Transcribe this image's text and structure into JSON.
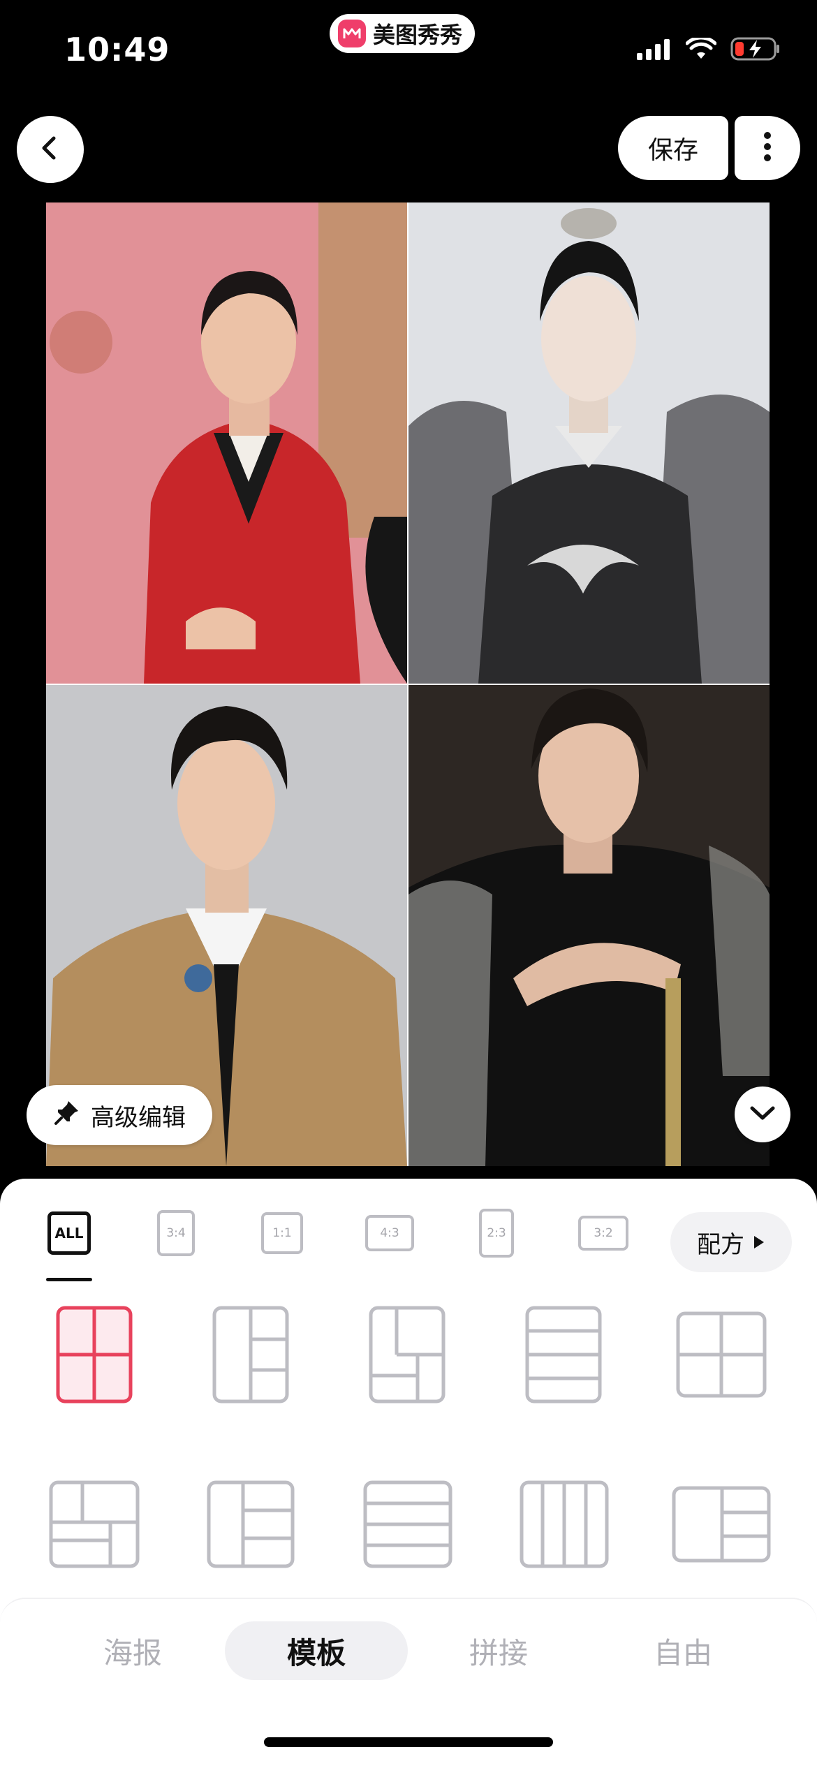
{
  "status_bar": {
    "time": "10:49",
    "app_name": "美图秀秀"
  },
  "header": {
    "save_label": "保存"
  },
  "collage": {
    "photos": [
      {
        "name": "photo-red-uniform"
      },
      {
        "name": "photo-fur-crane"
      },
      {
        "name": "photo-tan-suit"
      },
      {
        "name": "photo-black-embroidered"
      }
    ],
    "advanced_edit_label": "高级编辑"
  },
  "ratios": [
    {
      "label": "ALL",
      "active": true
    },
    {
      "label": "3:4"
    },
    {
      "label": "1:1"
    },
    {
      "label": "4:3"
    },
    {
      "label": "2:3"
    },
    {
      "label": "3:2"
    }
  ],
  "formula_label": "配方",
  "tabs": [
    {
      "label": "海报"
    },
    {
      "label": "模板",
      "active": true
    },
    {
      "label": "拼接"
    },
    {
      "label": "自由"
    }
  ],
  "colors": {
    "accent": "#e8425c",
    "outline": "#bdbdc3"
  }
}
